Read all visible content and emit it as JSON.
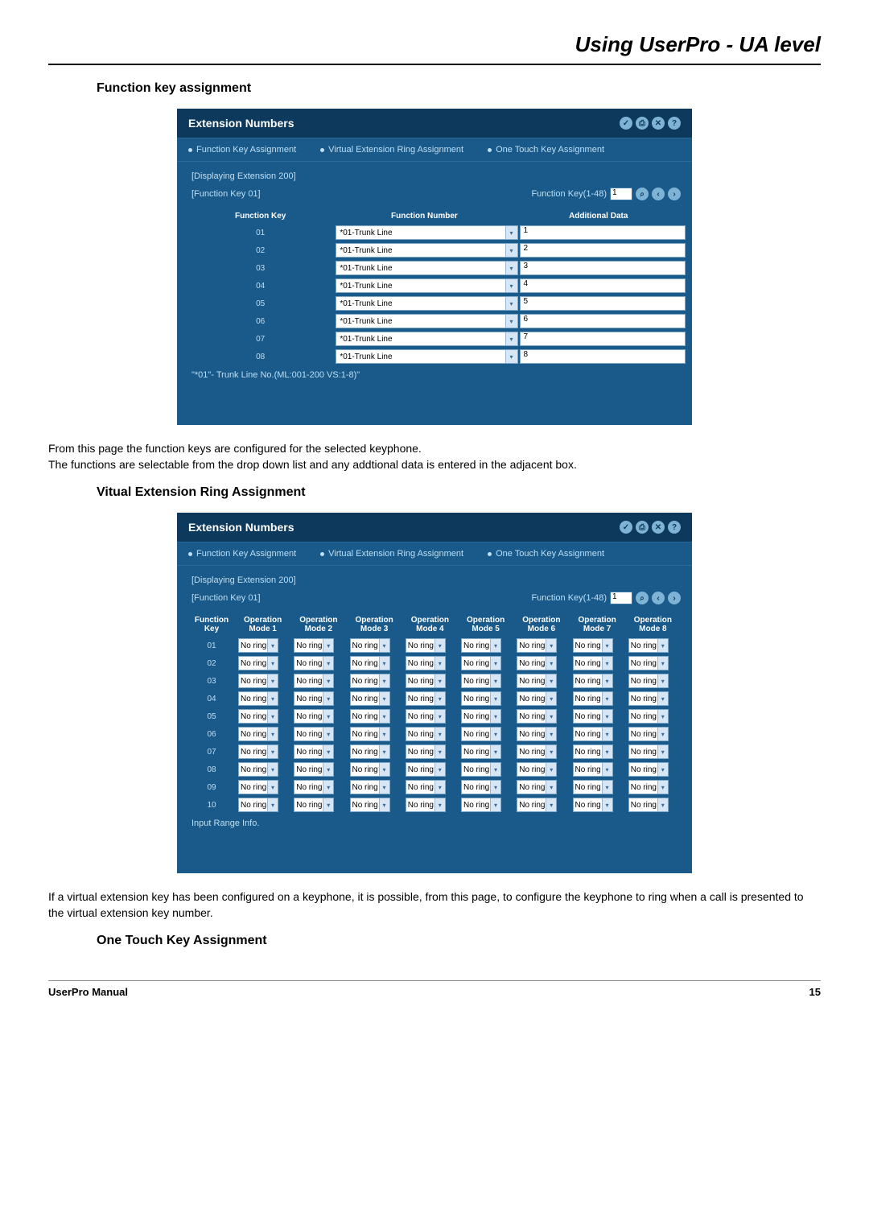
{
  "page_title": "Using UserPro - UA level",
  "section1": {
    "heading": "Function key assignment",
    "panel_title": "Extension Numbers",
    "tabs": [
      "Function Key Assignment",
      "Virtual Extension Ring Assignment",
      "One Touch Key Assignment"
    ],
    "display_line": "[Displaying Extension 200]",
    "fk_label": "[Function Key 01]",
    "nav_label": "Function Key(1-48)",
    "nav_value": "1",
    "headers": [
      "Function Key",
      "Function Number",
      "Additional Data"
    ],
    "rows": [
      {
        "key": "01",
        "fn": "*01-Trunk Line",
        "data": "1"
      },
      {
        "key": "02",
        "fn": "*01-Trunk Line",
        "data": "2"
      },
      {
        "key": "03",
        "fn": "*01-Trunk Line",
        "data": "3"
      },
      {
        "key": "04",
        "fn": "*01-Trunk Line",
        "data": "4"
      },
      {
        "key": "05",
        "fn": "*01-Trunk Line",
        "data": "5"
      },
      {
        "key": "06",
        "fn": "*01-Trunk Line",
        "data": "6"
      },
      {
        "key": "07",
        "fn": "*01-Trunk Line",
        "data": "7"
      },
      {
        "key": "08",
        "fn": "*01-Trunk Line",
        "data": "8"
      }
    ],
    "footnote": "\"*01\"- Trunk Line No.(ML:001-200 VS:1-8)\"",
    "body": "From this page the function keys are configured for the selected keyphone.\nThe functions are selectable from the drop down list and any addtional data is entered in the adjacent box."
  },
  "section2": {
    "heading": "Vitual Extension Ring Assignment",
    "panel_title": "Extension Numbers",
    "tabs": [
      "Function Key Assignment",
      "Virtual Extension Ring Assignment",
      "One Touch Key Assignment"
    ],
    "display_line": "[Displaying Extension 200]",
    "fk_label": "[Function Key 01]",
    "nav_label": "Function Key(1-48)",
    "nav_value": "1",
    "headers": [
      "Function Key",
      "Operation Mode 1",
      "Operation Mode 2",
      "Operation Mode 3",
      "Operation Mode 4",
      "Operation Mode 5",
      "Operation Mode 6",
      "Operation Mode 7",
      "Operation Mode 8"
    ],
    "rows": [
      "01",
      "02",
      "03",
      "04",
      "05",
      "06",
      "07",
      "08",
      "09",
      "10"
    ],
    "cell_value": "No ring",
    "footnote": "Input Range Info.",
    "body": "If a virtual extension key has been configured on a keyphone, it is possible, from this page, to configure the keyphone to ring when a call is presented to the virtual extension key number."
  },
  "section3": {
    "heading": "One Touch Key Assignment"
  },
  "icons": {
    "check": "✓",
    "print": "⎙",
    "close": "✕",
    "help": "?",
    "zoom": "⌕",
    "prev": "‹",
    "next": "›"
  },
  "footer": {
    "left": "UserPro Manual",
    "right": "15"
  }
}
